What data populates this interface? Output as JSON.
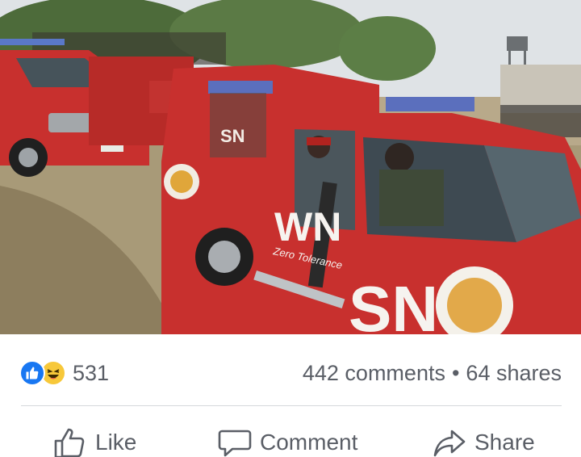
{
  "post": {
    "photo": {
      "alt": "",
      "vehicle_marks": [
        "WN",
        "SN"
      ],
      "vehicle_slogan": "Zero Tolerance"
    },
    "reactions": {
      "icons": [
        "like-icon",
        "haha-icon"
      ],
      "count": "531"
    },
    "engagement": {
      "comments": "442 comments",
      "separator": "•",
      "shares": "64 shares"
    },
    "actions": {
      "like": "Like",
      "comment": "Comment",
      "share": "Share"
    },
    "colors": {
      "like_blue": "#1877f2",
      "haha_yellow": "#f7c83a",
      "text_gray": "#5a5e66",
      "vehicle_red": "#c8302e"
    }
  }
}
